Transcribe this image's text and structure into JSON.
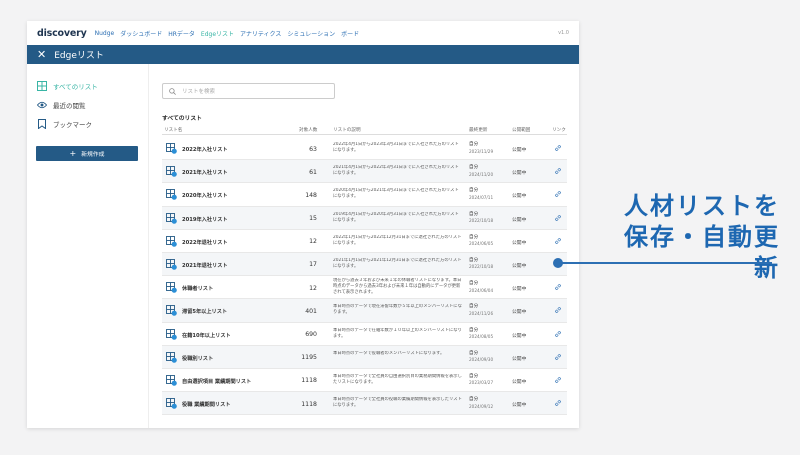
{
  "app": {
    "logo": "discovery",
    "version": "v1.0"
  },
  "nav": [
    "Nudge",
    "ダッシュボード",
    "HRデータ",
    "Edgeリスト",
    "アナリティクス",
    "シミュレーション",
    "ボード"
  ],
  "nav_active": "Edgeリスト",
  "titlebar": {
    "title": "Edgeリスト"
  },
  "sidebar": {
    "items": [
      {
        "label": "すべてのリスト",
        "icon": "grid-list-icon",
        "active": true
      },
      {
        "label": "最近の閲覧",
        "icon": "eye-icon",
        "active": false
      },
      {
        "label": "ブックマーク",
        "icon": "bookmark-icon",
        "active": false
      }
    ],
    "new_button": "新規作成"
  },
  "search": {
    "placeholder": "リストを検索"
  },
  "section_title": "すべてのリスト",
  "table": {
    "headers": {
      "name": "リスト名",
      "count": "対象人数",
      "desc": "リストの説明",
      "updated": "最終更新",
      "status": "公開範囲",
      "link": "リンク"
    },
    "rows": [
      {
        "name": "2022年入社リスト",
        "count": "63",
        "desc": "2022年4月1日から2023年3月31日までに入社された方のリストになります。",
        "updated_by": "自分",
        "date": "2023/11/29",
        "status": "公開中"
      },
      {
        "name": "2021年入社リスト",
        "count": "61",
        "desc": "2021年4月1日から2022年3月31日までに入社された方のリストになります。",
        "updated_by": "自分",
        "date": "2024/11/20",
        "status": "公開中"
      },
      {
        "name": "2020年入社リスト",
        "count": "148",
        "desc": "2020年4月1日から2021年3月31日までに入社された方のリストになります。",
        "updated_by": "自分",
        "date": "2024/07/11",
        "status": "公開中"
      },
      {
        "name": "2019年入社リスト",
        "count": "15",
        "desc": "2019年4月1日から2020年3月31日までに入社された方のリストになります。",
        "updated_by": "自分",
        "date": "2022/10/18",
        "status": "公開中"
      },
      {
        "name": "2022年退社リスト",
        "count": "12",
        "desc": "2022年1月1日から2022年12月31日までに退社された方のリストになります。",
        "updated_by": "自分",
        "date": "2024/06/05",
        "status": "公開中"
      },
      {
        "name": "2021年退社リスト",
        "count": "17",
        "desc": "2021年1月1日から2021年12月31日までに退社された方のリストになります。",
        "updated_by": "自分",
        "date": "2022/10/18",
        "status": "公開中"
      },
      {
        "name": "休職者リスト",
        "count": "12",
        "desc": "現在から過去３年および未来１年の休職者リストになります。本日時点のデータから過去3年および未来１年は自動的にデータが更新されて表示されます。",
        "updated_by": "自分",
        "date": "2024/06/04",
        "status": "公開中",
        "three": true
      },
      {
        "name": "滞留5年以上リスト",
        "count": "401",
        "desc": "本日時点のデータで現在滞留年数が５年以上のメンバーリストになります。",
        "updated_by": "自分",
        "date": "2024/11/26",
        "status": "公開中"
      },
      {
        "name": "在籍10年以上リスト",
        "count": "690",
        "desc": "本日時点のデータで在籍年数が１０年以上のメンバーリストになります。",
        "updated_by": "自分",
        "date": "2024/08/05",
        "status": "公開中"
      },
      {
        "name": "役職別リスト",
        "count": "1195",
        "desc": "本日時点のデータで役職者のメンバーリストになります。",
        "updated_by": "自分",
        "date": "2024/09/30",
        "status": "公開中"
      },
      {
        "name": "自由選択項目 業績期間リスト",
        "count": "1118",
        "desc": "本日時点のデータで全社員の自由選択別目の業務期間情報を表示したリストになります。",
        "updated_by": "自分",
        "date": "2023/03/27",
        "status": "公開中"
      },
      {
        "name": "役職 業績期間リスト",
        "count": "1118",
        "desc": "本日時点のデータで全社員の役職の業績期間情報を表示したリストになります。",
        "updated_by": "自分",
        "date": "2024/09/12",
        "status": "公開中"
      }
    ]
  },
  "callout": {
    "line1": "人材リストを",
    "line2": "保存・自動更新"
  },
  "colors": {
    "brand": "#245a86",
    "accent": "#39b5a5",
    "link": "#2c6fb3"
  }
}
